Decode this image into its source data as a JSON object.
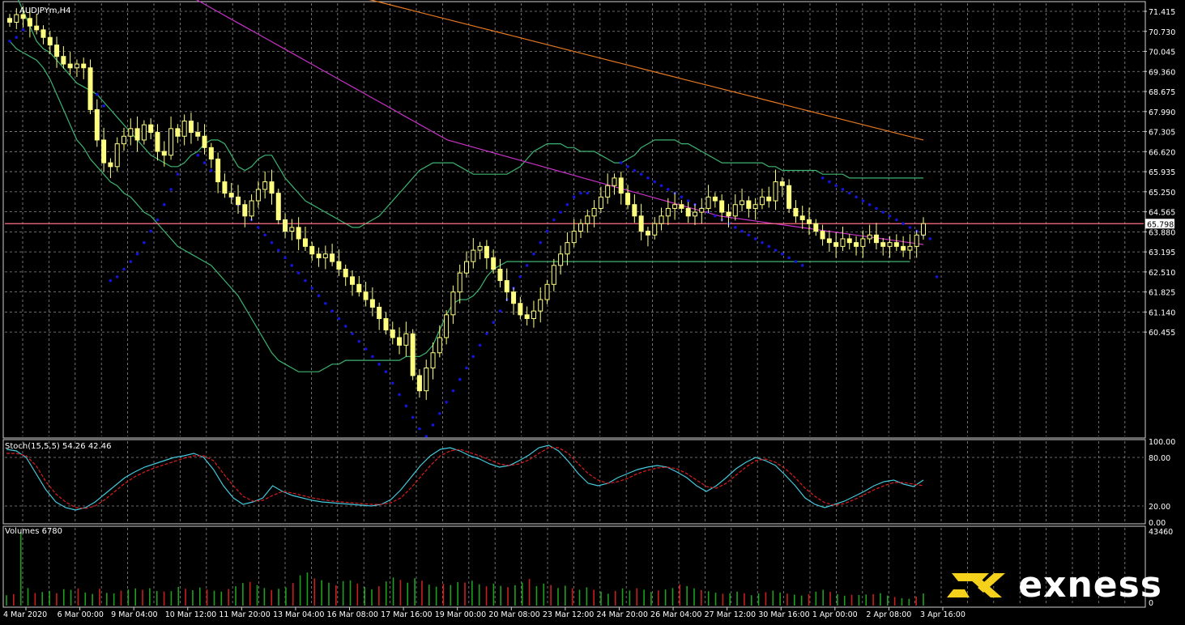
{
  "window": {
    "symbol_label": "AUDJPYm,H4",
    "price_pane_color": "#000000",
    "grid_color": "#8a8a8a"
  },
  "colors": {
    "candle": "#ffff80",
    "bollinger": "#3cb371",
    "sar": "#1414dc",
    "ma_fast": "#c832c8",
    "ma_slow": "#e6781e",
    "hline": "#ff6e82",
    "stoch_main": "#46c8dc",
    "stoch_signal": "#dc1e1e",
    "volume_up": "#1ea01e",
    "volume_down": "#c81e1e"
  },
  "price_axis": {
    "ticks": [
      "71.415",
      "70.730",
      "70.045",
      "69.360",
      "68.675",
      "67.990",
      "67.305",
      "66.620",
      "65.935",
      "65.250",
      "64.565",
      "63.880",
      "63.195",
      "62.510",
      "61.825",
      "61.140",
      "60.455"
    ],
    "current_price": "65.798"
  },
  "stoch": {
    "label": "Stoch(15,5,5) 54.26 42.46",
    "ticks": [
      "100.00",
      "80.00",
      "20.00",
      "0.00"
    ]
  },
  "volume": {
    "label": "Volumes 6780",
    "ticks": [
      "43460",
      "0"
    ]
  },
  "time_axis": {
    "labels": [
      "4 Mar 2020",
      "6 Mar 00:00",
      "9 Mar 04:00",
      "10 Mar 12:00",
      "11 Mar 20:00",
      "13 Mar 04:00",
      "16 Mar 08:00",
      "17 Mar 16:00",
      "19 Mar 00:00",
      "20 Mar 08:00",
      "23 Mar 12:00",
      "24 Mar 20:00",
      "26 Mar 04:00",
      "27 Mar 12:00",
      "30 Mar 16:00",
      "1 Apr 00:00",
      "2 Apr 08:00",
      "3 Apr 16:00"
    ]
  },
  "brand": {
    "name": "exness"
  },
  "chart_data": [
    {
      "type": "candlestick",
      "symbol": "AUDJPYm",
      "timeframe": "H4",
      "ylim": [
        60.2,
        71.6
      ],
      "close": [
        71.1,
        71.3,
        71.2,
        71.0,
        70.9,
        70.7,
        70.5,
        70.2,
        70.0,
        69.9,
        70.0,
        69.9,
        68.8,
        68.0,
        67.4,
        67.3,
        67.9,
        68.1,
        68.3,
        68.0,
        68.4,
        68.2,
        67.7,
        67.6,
        68.3,
        68.1,
        68.5,
        68.2,
        68.1,
        67.8,
        67.5,
        66.9,
        66.6,
        66.5,
        66.3,
        66.0,
        66.4,
        66.7,
        66.9,
        66.6,
        65.9,
        65.6,
        65.7,
        65.4,
        65.2,
        65.0,
        64.9,
        65.0,
        64.8,
        64.6,
        64.4,
        64.2,
        64.0,
        63.8,
        63.6,
        63.3,
        63.0,
        62.8,
        62.6,
        62.9,
        61.8,
        61.4,
        62.0,
        62.4,
        62.8,
        63.4,
        64.0,
        64.5,
        64.8,
        65.1,
        65.2,
        64.9,
        64.6,
        64.3,
        64.0,
        63.7,
        63.4,
        63.3,
        63.5,
        63.8,
        64.2,
        64.7,
        65.0,
        65.3,
        65.6,
        65.8,
        66.0,
        66.2,
        66.5,
        66.8,
        67.0,
        66.6,
        66.3,
        66.0,
        65.6,
        65.5,
        65.8,
        66.0,
        66.2,
        66.3,
        66.2,
        66.0,
        66.1,
        66.2,
        66.5,
        66.4,
        66.1,
        66.0,
        66.3,
        66.4,
        66.2,
        66.3,
        66.5,
        66.4,
        66.9,
        66.8,
        66.2,
        66.0,
        65.9,
        65.8,
        65.6,
        65.4,
        65.3,
        65.2,
        65.4,
        65.3,
        65.2,
        65.4,
        65.5,
        65.3,
        65.2,
        65.3,
        65.2,
        65.1,
        65.2,
        65.5,
        65.8
      ],
      "bollinger_upper": [
        72.0,
        71.8,
        71.4,
        71.0,
        70.6,
        70.4,
        70.3,
        70.1,
        69.9,
        69.7,
        69.5,
        69.4,
        69.3,
        69.2,
        69.0,
        68.8,
        68.6,
        68.4,
        68.2,
        68.0,
        67.8,
        67.6,
        67.5,
        67.4,
        67.3,
        67.3,
        67.4,
        67.6,
        67.7,
        67.9,
        68.0,
        68.0,
        67.9,
        67.6,
        67.3,
        67.2,
        67.3,
        67.5,
        67.6,
        67.6,
        67.3,
        67.0,
        66.8,
        66.6,
        66.4,
        66.3,
        66.2,
        66.1,
        66.0,
        65.9,
        65.8,
        65.7,
        65.7,
        65.8,
        65.9,
        66.0,
        66.2,
        66.4,
        66.6,
        66.8,
        67.0,
        67.2,
        67.3,
        67.4,
        67.4,
        67.4,
        67.4,
        67.3,
        67.2,
        67.1,
        67.1,
        67.1,
        67.1,
        67.1,
        67.1,
        67.2,
        67.3,
        67.5,
        67.7,
        67.8,
        67.9,
        67.9,
        67.9,
        67.8,
        67.8,
        67.7,
        67.7,
        67.7,
        67.6,
        67.5,
        67.4,
        67.4,
        67.5,
        67.6,
        67.8,
        67.9,
        68.0,
        68.0,
        68.0,
        68.0,
        67.9,
        67.9,
        67.8,
        67.7,
        67.6,
        67.5,
        67.4,
        67.4,
        67.4,
        67.4,
        67.4,
        67.4,
        67.4,
        67.3,
        67.3,
        67.2,
        67.2,
        67.2,
        67.2,
        67.2,
        67.2,
        67.1,
        67.1,
        67.1,
        67.1,
        67.0,
        67.0,
        67.0,
        67.0,
        67.0,
        67.0,
        67.0,
        67.0,
        67.0,
        67.0,
        67.0,
        67.0
      ],
      "bollinger_lower": [
        70.6,
        70.4,
        70.3,
        70.2,
        70.1,
        69.9,
        69.6,
        69.2,
        68.8,
        68.4,
        68.0,
        67.8,
        67.5,
        67.3,
        67.1,
        66.9,
        66.8,
        66.6,
        66.5,
        66.3,
        66.1,
        66.0,
        65.8,
        65.6,
        65.4,
        65.2,
        65.1,
        65.0,
        64.9,
        64.8,
        64.7,
        64.5,
        64.3,
        64.1,
        63.9,
        63.6,
        63.3,
        63.0,
        62.7,
        62.4,
        62.2,
        62.1,
        62.0,
        61.9,
        61.9,
        61.9,
        61.9,
        62.0,
        62.1,
        62.1,
        62.2,
        62.2,
        62.2,
        62.2,
        62.2,
        62.2,
        62.2,
        62.2,
        62.2,
        62.3,
        62.3,
        62.3,
        62.4,
        62.6,
        63.0,
        63.4,
        63.7,
        63.8,
        63.8,
        63.9,
        64.1,
        64.4,
        64.6,
        64.7,
        64.8,
        64.8,
        64.8,
        64.8,
        64.8,
        64.8,
        64.8,
        64.8,
        64.8,
        64.8,
        64.8,
        64.8,
        64.8,
        64.8,
        64.8,
        64.8,
        64.8,
        64.8,
        64.8,
        64.8,
        64.8,
        64.8,
        64.8,
        64.8,
        64.8,
        64.8,
        64.8,
        64.8,
        64.8,
        64.8,
        64.8,
        64.8,
        64.8,
        64.8,
        64.8,
        64.8,
        64.8,
        64.8,
        64.8,
        64.8,
        64.8,
        64.8,
        64.8,
        64.8,
        64.8,
        64.8,
        64.8,
        64.8,
        64.8,
        64.8,
        64.8,
        64.8,
        64.8,
        64.8,
        64.8,
        64.8,
        64.8,
        64.8,
        64.8,
        64.8,
        64.8
      ],
      "sar": [
        70.6,
        70.7,
        70.9,
        null,
        null,
        null,
        null,
        null,
        null,
        null,
        null,
        null,
        null,
        69.2,
        68.9,
        64.3,
        64.4,
        64.6,
        64.8,
        65.0,
        65.3,
        65.6,
        65.9,
        66.3,
        66.7,
        67.1,
        null,
        null,
        67.6,
        67.4,
        67.2,
        67.0,
        66.8,
        66.5,
        66.3,
        66.1,
        65.9,
        65.7,
        65.5,
        65.3,
        65.1,
        64.9,
        64.7,
        64.5,
        64.3,
        64.1,
        63.9,
        63.7,
        63.5,
        63.3,
        63.1,
        62.9,
        62.7,
        62.5,
        62.3,
        62.1,
        61.9,
        61.6,
        61.3,
        61.0,
        60.7,
        60.4,
        60.2,
        60.5,
        60.8,
        61.1,
        61.4,
        61.7,
        62.0,
        62.3,
        62.6,
        62.9,
        63.2,
        63.5,
        63.8,
        64.1,
        64.4,
        64.7,
        65.0,
        65.3,
        65.6,
        65.9,
        66.1,
        66.3,
        66.5,
        66.6,
        66.6,
        null,
        null,
        null,
        null,
        67.4,
        67.3,
        67.2,
        67.1,
        67.0,
        66.9,
        66.8,
        66.7,
        66.6,
        66.5,
        66.4,
        66.3,
        66.2,
        66.1,
        66.0,
        65.9,
        65.8,
        65.7,
        65.6,
        65.5,
        65.4,
        65.3,
        65.2,
        65.1,
        65.0,
        64.9,
        64.8,
        64.7,
        null,
        null,
        67.0,
        66.9,
        66.8,
        66.7,
        66.6,
        66.5,
        66.4,
        66.3,
        66.2,
        66.1,
        66.0,
        65.9,
        65.8,
        65.7,
        65.6,
        65.5,
        65.4,
        64.4
      ],
      "ma_fast": [
        72.0,
        71.9,
        71.8,
        71.6,
        71.4,
        71.2,
        71.0,
        70.8,
        70.6,
        70.4,
        70.2,
        70.0,
        69.8,
        69.6,
        69.4,
        69.2,
        69.0,
        68.8,
        68.6,
        68.4,
        68.2,
        68.0,
        67.9,
        67.8,
        67.7,
        67.6,
        67.5,
        67.4,
        67.3,
        67.2,
        67.1,
        67.0,
        66.9,
        66.8,
        66.7,
        66.6,
        66.5,
        66.4,
        66.3,
        66.2,
        66.1,
        66.0,
        65.95,
        65.9,
        65.85,
        65.8,
        65.75,
        65.7,
        65.65,
        65.6,
        65.55,
        65.5,
        65.45,
        65.4,
        65.35,
        65.3,
        65.25
      ],
      "ma_slow": [
        72.0,
        71.8,
        71.6,
        71.4,
        71.2,
        71.0,
        70.8,
        70.6,
        70.4,
        70.2,
        70.0,
        69.8,
        69.6,
        69.4,
        69.2,
        69.0,
        68.8,
        68.6,
        68.4,
        68.2,
        68.0
      ],
      "hline": 65.798,
      "current_price": 65.798
    },
    {
      "type": "line",
      "title": "Stoch(15,5,5) 54.26 42.46",
      "ylim": [
        0,
        100
      ],
      "series": [
        {
          "name": "main",
          "values": [
            90,
            88,
            80,
            60,
            40,
            25,
            18,
            15,
            18,
            25,
            35,
            45,
            55,
            62,
            68,
            72,
            76,
            80,
            82,
            85,
            80,
            65,
            45,
            30,
            22,
            25,
            30,
            45,
            38,
            33,
            30,
            27,
            25,
            24,
            23,
            22,
            21,
            20,
            22,
            28,
            40,
            55,
            70,
            82,
            90,
            92,
            88,
            82,
            78,
            72,
            68,
            70,
            76,
            83,
            92,
            95,
            88,
            75,
            60,
            48,
            45,
            48,
            55,
            60,
            65,
            68,
            70,
            68,
            62,
            55,
            45,
            38,
            45,
            55,
            66,
            74,
            80,
            76,
            70,
            58,
            45,
            30,
            22,
            18,
            22,
            26,
            32,
            38,
            45,
            50,
            52,
            47,
            44,
            52
          ]
        },
        {
          "name": "signal",
          "values": [
            85,
            85,
            82,
            70,
            50,
            35,
            25,
            18,
            17,
            20,
            28,
            38,
            48,
            56,
            62,
            67,
            71,
            75,
            79,
            82,
            82,
            76,
            60,
            45,
            32,
            26,
            27,
            33,
            38,
            36,
            33,
            30,
            28,
            26,
            25,
            24,
            23,
            22,
            22,
            24,
            30,
            42,
            56,
            70,
            82,
            88,
            90,
            86,
            82,
            77,
            72,
            70,
            72,
            77,
            85,
            92,
            92,
            85,
            72,
            60,
            52,
            48,
            50,
            54,
            60,
            64,
            67,
            68,
            66,
            60,
            52,
            44,
            42,
            48,
            58,
            68,
            76,
            78,
            74,
            66,
            55,
            42,
            32,
            24,
            21,
            23,
            28,
            34,
            40,
            45,
            49,
            49,
            47,
            45
          ]
        }
      ]
    },
    {
      "type": "bar",
      "title": "Volumes 6780",
      "ylim": [
        0,
        43460
      ],
      "values": [
        5800,
        6400,
        41000,
        9800,
        7000,
        7600,
        8200,
        6900,
        9200,
        8800,
        9600,
        7300,
        6500,
        9400,
        7100,
        6800,
        8300,
        9000,
        9600,
        8800,
        9700,
        8200,
        7900,
        8100,
        10500,
        9400,
        8600,
        10100,
        9000,
        8300,
        7800,
        9300,
        10800,
        12600,
        13200,
        11400,
        9800,
        8700,
        9400,
        10100,
        12600,
        16900,
        18500,
        15200,
        14200,
        12800,
        11300,
        13700,
        14100,
        12300,
        10400,
        9100,
        10800,
        13500,
        15700,
        14300,
        12800,
        15300,
        13900,
        11700,
        10600,
        12200,
        11500,
        13100,
        12900,
        13900,
        11900,
        10800,
        12300,
        11000,
        10300,
        11400,
        12900,
        14900,
        10900,
        12300,
        11500,
        9800,
        11100,
        9700,
        8800,
        10200,
        8800,
        7800,
        6600,
        8200,
        9600,
        8400,
        9700,
        8900,
        7600,
        8500,
        9000,
        9800,
        11800,
        10900,
        9600,
        8700,
        8000,
        7200,
        6600,
        6900,
        7800,
        6900,
        5800,
        6800,
        7500,
        8400,
        7300,
        6700,
        6100,
        5600,
        6400,
        7800,
        8800,
        7700,
        6400,
        5500,
        6000,
        5900,
        6200,
        6400,
        6900,
        5600,
        4800,
        4100,
        3800,
        5000,
        6780
      ]
    }
  ]
}
